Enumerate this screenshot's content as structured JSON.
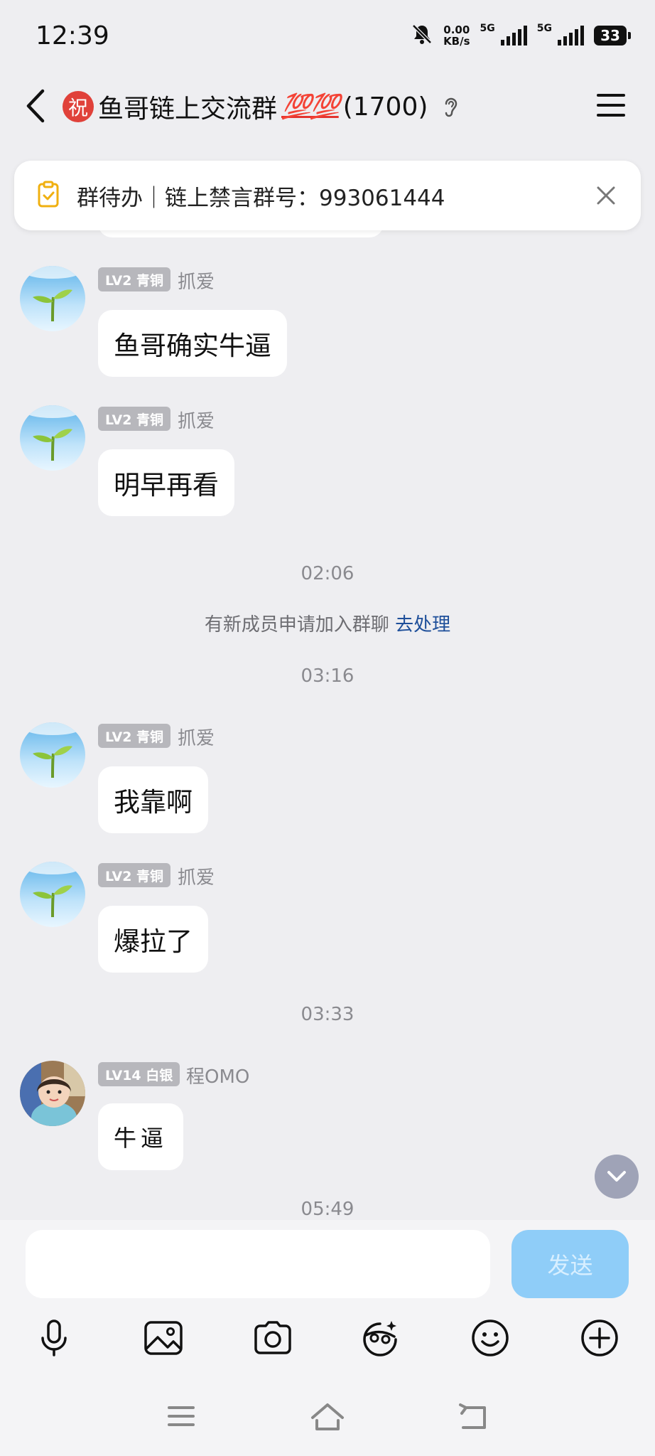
{
  "status_bar": {
    "time": "12:39",
    "speed_value": "0.00",
    "speed_unit": "KB/s",
    "network1": "5G",
    "network2": "5G",
    "battery": "33"
  },
  "header": {
    "badge_char": "祝",
    "title": "鱼哥链上交流群",
    "emoji": "💯💯",
    "member_count": "(1700)"
  },
  "pinned": {
    "text": "群待办｜链上禁言群号：993061444"
  },
  "messages": [
    {
      "badge": "LV2 青铜",
      "sender": "抓爱",
      "text": "鱼哥确实牛逼"
    },
    {
      "badge": "LV2 青铜",
      "sender": "抓爱",
      "text": "明早再看"
    },
    {
      "badge": "LV2 青铜",
      "sender": "抓爱",
      "text": "我靠啊"
    },
    {
      "badge": "LV2 青铜",
      "sender": "抓爱",
      "text": "爆拉了"
    },
    {
      "badge": "LV14 白银",
      "sender": "程OMO",
      "text": "牛逼"
    }
  ],
  "timestamps": [
    "02:06",
    "03:16",
    "03:33",
    "05:49"
  ],
  "system_notice": {
    "text": "有新成员申请加入群聊",
    "action": "去处理"
  },
  "composer": {
    "placeholder": "",
    "send_label": "发送"
  },
  "colors": {
    "accent_blue": "#1e4f9a",
    "send_button": "#8fcdf8",
    "badge_gray": "#b7b7bc",
    "title_badge_red": "#e0413a"
  },
  "toolbar_icons": [
    "microphone-icon",
    "image-icon",
    "camera-icon",
    "sticker-icon",
    "emoji-icon",
    "plus-icon"
  ]
}
